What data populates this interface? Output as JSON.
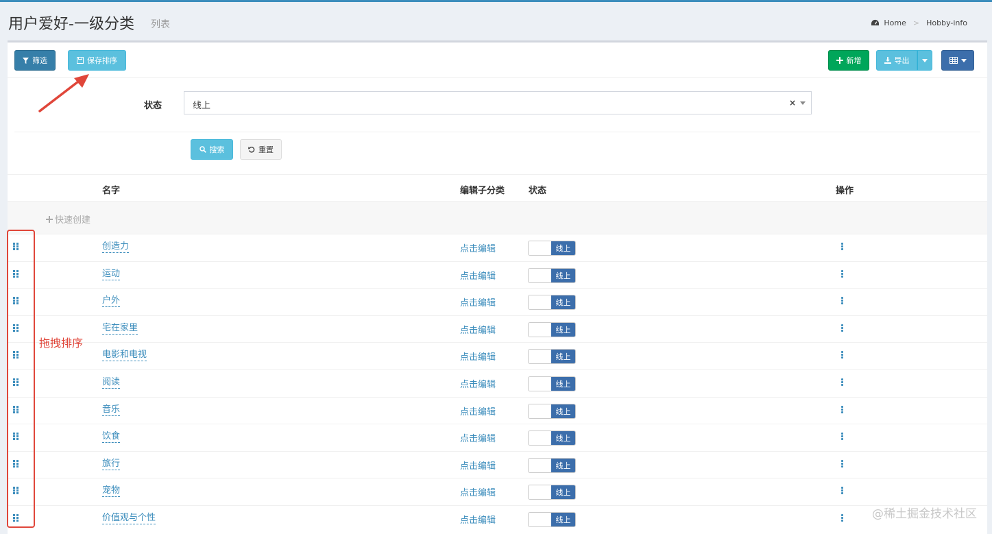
{
  "header": {
    "title": "用户爱好-一级分类",
    "subtitle": "列表",
    "breadcrumb": {
      "home": "Home",
      "current": "Hobby-info"
    }
  },
  "toolbar": {
    "filter_label": "筛选",
    "save_sort_label": "保存排序",
    "new_label": "新增",
    "export_label": "导出"
  },
  "filter": {
    "status_label": "状态",
    "status_value": "线上",
    "clear_symbol": "×",
    "search_label": "搜索",
    "reset_label": "重置"
  },
  "table": {
    "columns": {
      "name": "名字",
      "edit_sub": "编辑子分类",
      "status": "状态",
      "actions": "操作"
    },
    "quick_create": "快速创建",
    "rows": [
      {
        "name": "创造力",
        "edit": "点击编辑",
        "status": "线上"
      },
      {
        "name": "运动",
        "edit": "点击编辑",
        "status": "线上"
      },
      {
        "name": "户外",
        "edit": "点击编辑",
        "status": "线上"
      },
      {
        "name": "宅在家里",
        "edit": "点击编辑",
        "status": "线上"
      },
      {
        "name": "电影和电视",
        "edit": "点击编辑",
        "status": "线上"
      },
      {
        "name": "阅读",
        "edit": "点击编辑",
        "status": "线上"
      },
      {
        "name": "音乐",
        "edit": "点击编辑",
        "status": "线上"
      },
      {
        "name": "饮食",
        "edit": "点击编辑",
        "status": "线上"
      },
      {
        "name": "旅行",
        "edit": "点击编辑",
        "status": "线上"
      },
      {
        "name": "宠物",
        "edit": "点击编辑",
        "status": "线上"
      },
      {
        "name": "价值观与个性",
        "edit": "点击编辑",
        "status": "线上"
      }
    ]
  },
  "annotation": {
    "drag_sort": "拖拽排序",
    "color": "#e0463a"
  },
  "watermark": "@稀土掘金技术社区",
  "colors": {
    "primary": "#3c8dbc",
    "success": "#00a65a",
    "info": "#5bc0de",
    "toggle_on": "#3c6eab"
  }
}
